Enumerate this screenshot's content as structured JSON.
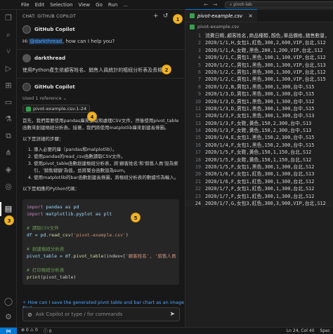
{
  "titlebar": {
    "menu": [
      "File",
      "Edit",
      "Selection",
      "View",
      "Go",
      "Run",
      "..."
    ],
    "search_text": "pivot-lab"
  },
  "chat": {
    "header": "CHAT: GITHUB COPILOT",
    "copilot_name": "GitHub Copilot",
    "greeting_prefix": "Hi ",
    "greeting_mention": "@darkthread",
    "greeting_suffix": ", how can I help you?",
    "user_name": "darkthread",
    "user_message": "使用Python產生依顧客姓名、銷售人員統計的樞紐分析表及長條圖",
    "used_refs": "Used 1 reference ⌄",
    "ref_chip": "pivot-example.csv:1-24",
    "para1": "首先，我們需要使用pandas庫來讀取和處理CSV文件，然後使用pivot_table函數來創建樞紐分析表。接著，我們將使用matplotlib庫來創建長條圖。",
    "para2": "以下是詳細的步驟：",
    "steps": [
      "導入必要的庫（pandas和matplotlib）。",
      "使用pandas的read_csv函數讀取CSV文件。",
      "使用pivot_table函數創建樞紐分析表，將'顧客姓名'和'銷售人員'設為索引，'銷售總額'為值，並將聚合函數設為sum。",
      "使用matplotlib的bar函數創建長條圖，將樞紐分析表的數據作為輸入。"
    ],
    "para3": "以下是相應的Python代碼：",
    "followup": "How can I save the generated pivot table and bar chart as an image file?",
    "input_placeholder": "Ask Copilot or type / for commands"
  },
  "code": {
    "import1_kw": "import",
    "import1_rest": " pandas as pd",
    "import2_kw": "import",
    "import2_rest": " matplotlib.pyplot as plt",
    "c1": "# 讀取CSV文件",
    "l4a": "df = pd.",
    "l4fn": "read_csv",
    "l4b": "(",
    "l4s": "'pivot-example.csv'",
    "l4c": ")",
    "c2": "# 創建樞紐分析表",
    "l6a": "pivot_table = df.",
    "l6fn": "pivot_table",
    "l6b": "(index=[",
    "l6s": "'顧客姓名', '銷售人員",
    "c3": "# 打印樞紐分析表",
    "l8fn": "print",
    "l8b": "(pivot_table)"
  },
  "callouts": [
    "1",
    "2",
    "3",
    "4",
    "5"
  ],
  "editor": {
    "tab_name": "pivot-example.csv",
    "breadcrumb": "pivot-example.csv",
    "lines": [
      "消費日期,顧客姓名,商品種類,顏色,單品價格,銷售數量,",
      "2020/1/1,H,女包1,紅色,300,2,600,VIP,台北,S12",
      "2020/1/1,A,女鞋,黑色,200,1,200,VIP,台北,S12",
      "2020/1/1,C,男包1,黑色,100,1,100,VIP,台北,S12",
      "2020/1/2,C,男包1,黑色,300,1,300,VIP,台北,S13",
      "2020/1/2,C,男包1,黑色,300,1,300,VIP,台北,S12",
      "2020/1/2,C,男包1,黑色,300,1,300,VIP,台北,S15",
      "2020/1/2,B,男包1,黑色,300,1,300,台中,S15",
      "2020/1/3,D,男包1,黑色,300,1,300,台中,S15",
      "2020/1/3,D,男包1,黑色,300,1,300,台中,S12",
      "2020/1/3,D,男包1,黑色,300,1,300,台中,S15",
      "2020/1/3,F,女包1,黑色,300,1,300,台中,S13",
      "2020/1/3,F,女鞋,黃色,150,2,300,台中,S13",
      "2020/1/3,F,女鞋,黃色,150,2,300,台中,S13",
      "2020/1/4,E,女包1,黑色,150,2,300,台中,S15",
      "2020/1/4,F,女包1,黑色,150,2,300,台中,S15",
      "2020/1/5,F,女鞋,黃色,150,1,150,台北,S12",
      "2020/1/5,F,女鞋,黃色,150,1,150,台北,S12",
      "2020/1/5,F,女包1,黑色,300,1,300,台北,S12",
      "2020/1/6,F,女包1,紅色,300,1,300,台北,S13",
      "2020/1/6,F,女包1,紅色,300,1,300,台北,S12",
      "2020/1/7,F,女包1,紅色,300,1,300,台北,S12",
      "2020/1/7,F,女包1,紅色,300,1,300,台北,S12",
      "2020/1/7,G,女包3,紅色,300,3,900,VIP,台北,S12"
    ]
  },
  "status": {
    "left": [
      "⊗ 0 ⚠ 0",
      "ⓘ 0"
    ],
    "right": [
      "Ln 24, Col 40",
      "Spac"
    ]
  }
}
